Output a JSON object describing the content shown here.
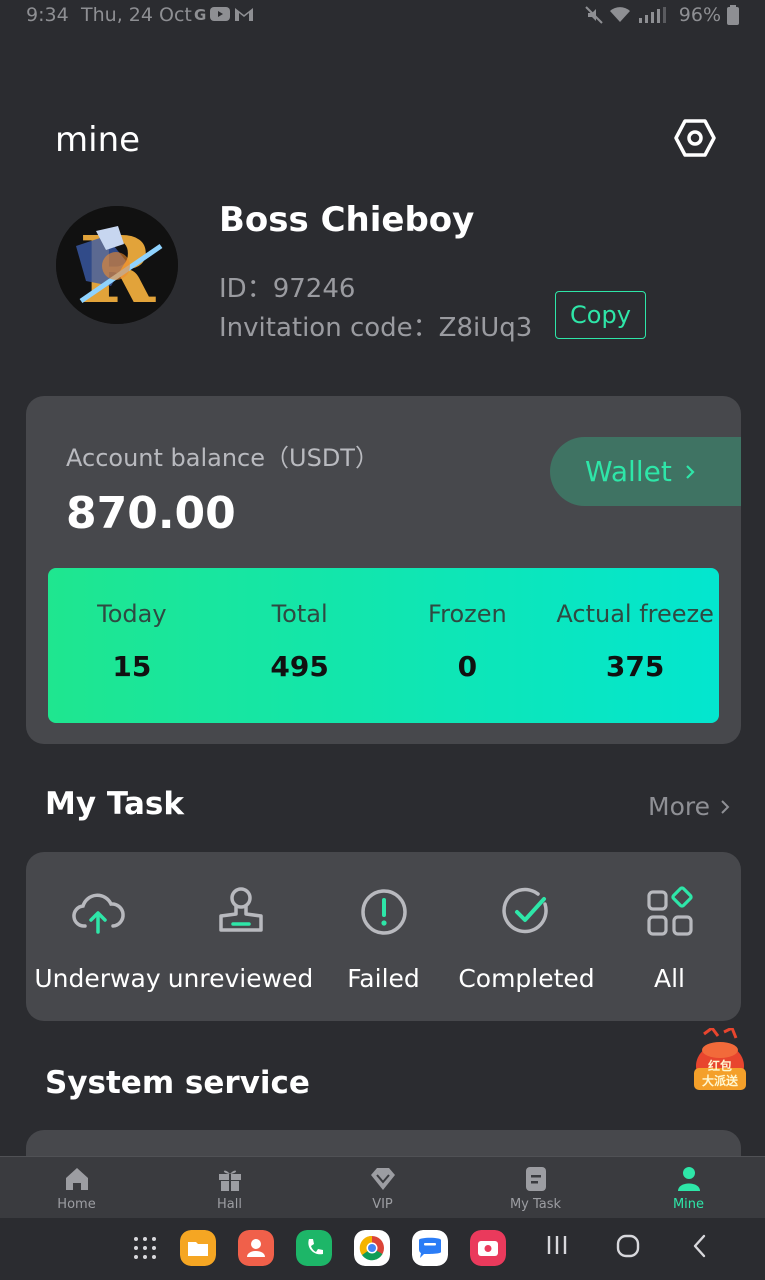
{
  "status_bar": {
    "time": "9:34",
    "date": "Thu, 24 Oct",
    "left_icons": [
      "google-icon",
      "youtube-icon",
      "gmail-icon"
    ],
    "right_icons": [
      "mute-icon",
      "wifi-icon",
      "signal-icon"
    ],
    "battery": "96%"
  },
  "header": {
    "title": "mine",
    "settings_icon": "hexagon-settings-icon"
  },
  "profile": {
    "name": "Boss Chieboy",
    "id_label": "ID：",
    "id_value": "97246",
    "invite_label": "Invitation code：",
    "invite_value": "Z8iUq3",
    "copy_label": "Copy"
  },
  "balance": {
    "label": "Account balance（USDT）",
    "value": "870.00",
    "wallet_label": "Wallet",
    "stats": [
      {
        "label": "Today",
        "value": "15"
      },
      {
        "label": "Total",
        "value": "495"
      },
      {
        "label": "Frozen",
        "value": "0"
      },
      {
        "label": "Actual freeze",
        "value": "375"
      }
    ]
  },
  "my_task": {
    "title": "My Task",
    "more_label": "More",
    "items": [
      {
        "label": "Underway",
        "icon": "cloud-upload-icon"
      },
      {
        "label": "unreviewed",
        "icon": "stamp-icon"
      },
      {
        "label": "Failed",
        "icon": "exclamation-circle-icon"
      },
      {
        "label": "Completed",
        "icon": "check-circle-icon"
      },
      {
        "label": "All",
        "icon": "grid-icon"
      }
    ]
  },
  "promo": {
    "line1": "红包",
    "line2": "大派送"
  },
  "system_service": {
    "title": "System service"
  },
  "bottom_nav": {
    "items": [
      {
        "label": "Home",
        "icon": "home-icon"
      },
      {
        "label": "Hall",
        "icon": "gift-icon"
      },
      {
        "label": "VIP",
        "icon": "diamond-icon"
      },
      {
        "label": "My Task",
        "icon": "task-list-icon"
      },
      {
        "label": "Mine",
        "icon": "person-icon"
      }
    ],
    "active": "Mine"
  },
  "colors": {
    "accent": "#2ee6a8",
    "card": "#47484c",
    "background": "#2b2c30"
  }
}
